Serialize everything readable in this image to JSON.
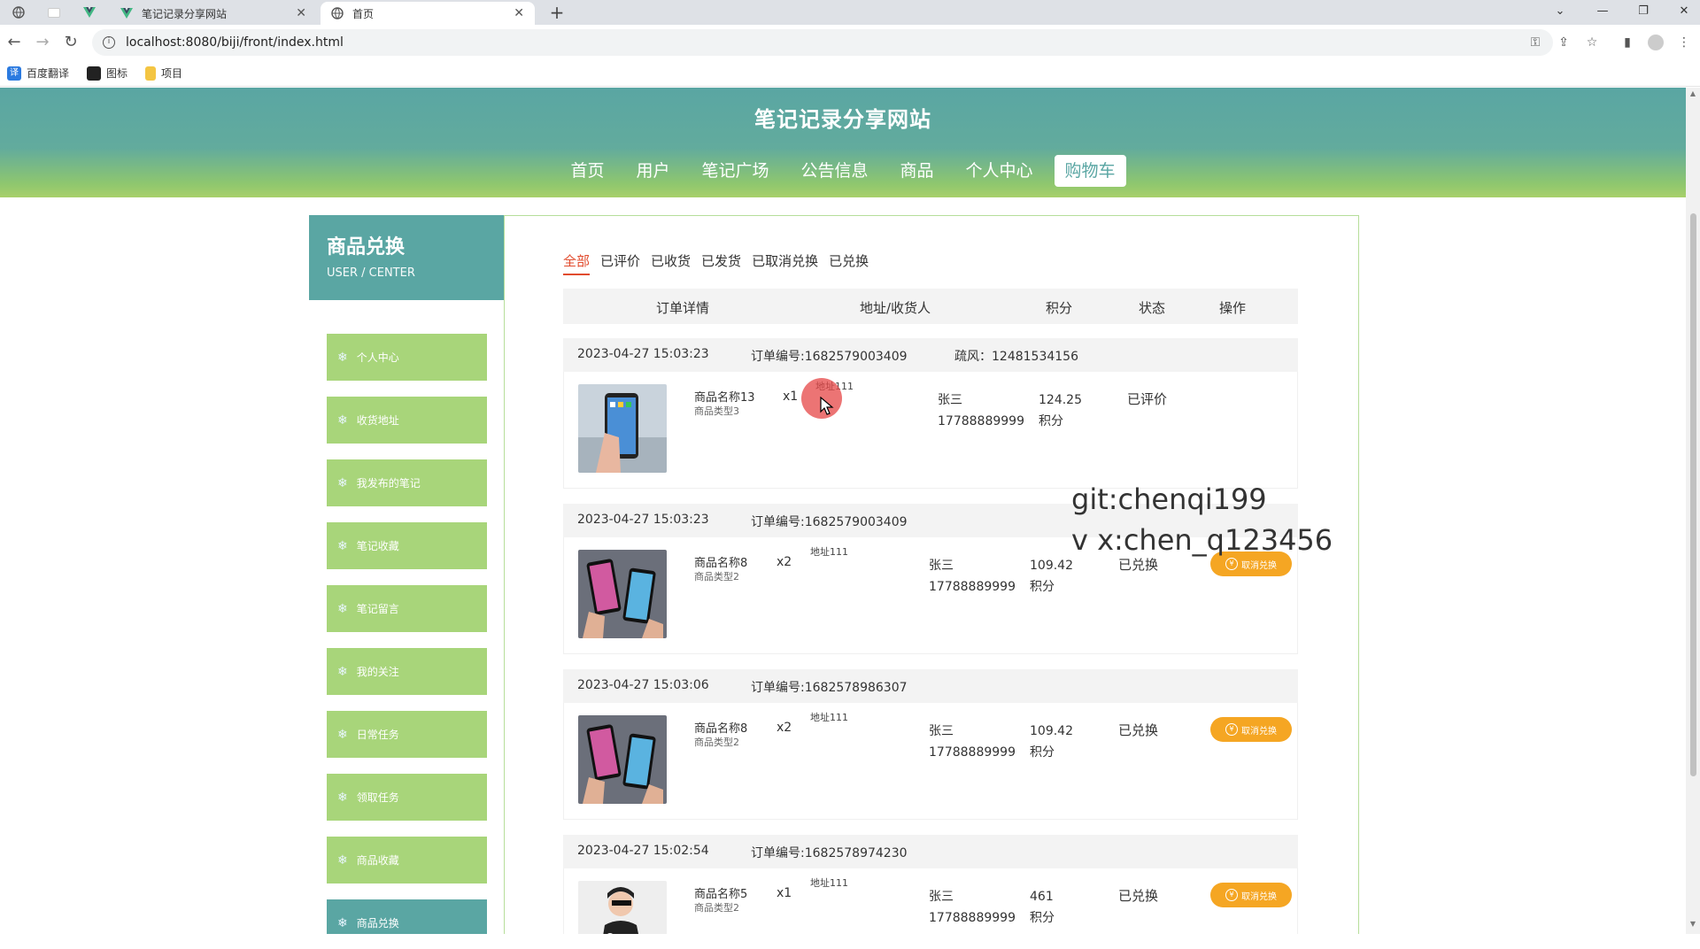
{
  "browser": {
    "tabs": [
      {
        "title": "笔记记录分享网站",
        "close": "✕"
      },
      {
        "title": "首页",
        "close": "✕"
      }
    ],
    "new_tab": "+",
    "url": "localhost:8080/biji/front/index.html",
    "bookmarks": [
      "百度翻译",
      "图标",
      "项目"
    ]
  },
  "site": {
    "title": "笔记记录分享网站",
    "nav": [
      "首页",
      "用户",
      "笔记广场",
      "公告信息",
      "商品",
      "个人中心",
      "购物车"
    ],
    "active_nav": "购物车"
  },
  "sidebar": {
    "title": "商品兑换",
    "subtitle": "USER / CENTER",
    "items": [
      "个人中心",
      "收货地址",
      "我发布的笔记",
      "笔记收藏",
      "笔记留言",
      "我的关注",
      "日常任务",
      "领取任务",
      "商品收藏",
      "商品兑换"
    ],
    "active": "商品兑换"
  },
  "filters": [
    "全部",
    "已评价",
    "已收货",
    "已发货",
    "已取消兑换",
    "已兑换"
  ],
  "active_filter": "全部",
  "table_headers": [
    "订单详情",
    "地址/收货人",
    "积分",
    "状态",
    "操作"
  ],
  "orders": [
    {
      "time": "2023-04-27 15:03:23",
      "order_no": "订单编号:1682579003409",
      "extra": "疏风：12481534156",
      "name": "商品名称13",
      "type": "商品类型3",
      "qty": "x1",
      "address": "地址111",
      "receiver": "张三",
      "phone": "17788889999",
      "points": "124.25",
      "points_unit": "积分",
      "status": "已评价",
      "action": ""
    },
    {
      "time": "2023-04-27 15:03:23",
      "order_no": "订单编号:1682579003409",
      "extra": "",
      "name": "商品名称8",
      "type": "商品类型2",
      "qty": "x2",
      "address": "地址111",
      "receiver": "张三",
      "phone": "17788889999",
      "points": "109.42",
      "points_unit": "积分",
      "status": "已兑换",
      "action": "取消兑换"
    },
    {
      "time": "2023-04-27 15:03:06",
      "order_no": "订单编号:1682578986307",
      "extra": "",
      "name": "商品名称8",
      "type": "商品类型2",
      "qty": "x2",
      "address": "地址111",
      "receiver": "张三",
      "phone": "17788889999",
      "points": "109.42",
      "points_unit": "积分",
      "status": "已兑换",
      "action": "取消兑换"
    },
    {
      "time": "2023-04-27 15:02:54",
      "order_no": "订单编号:1682578974230",
      "extra": "",
      "name": "商品名称5",
      "type": "商品类型2",
      "qty": "x1",
      "address": "地址111",
      "receiver": "张三",
      "phone": "17788889999",
      "points": "461",
      "points_unit": "积分",
      "status": "已兑换",
      "action": "取消兑换"
    }
  ],
  "watermark": [
    "git:chenqi199",
    "v x:chen_q123456"
  ],
  "colors": {
    "primary": "#5aa6a3",
    "menu": "#a8d57a",
    "accent": "#e14b2d",
    "button": "#f5a623"
  }
}
